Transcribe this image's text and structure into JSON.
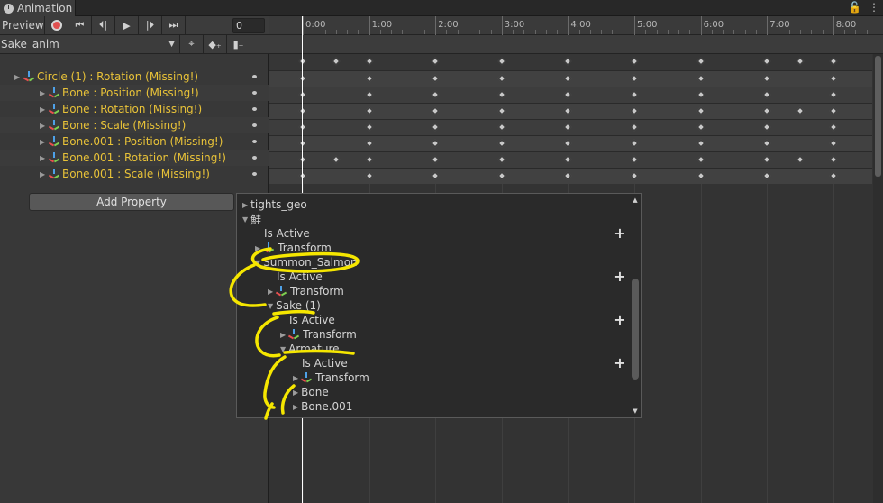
{
  "window": {
    "tab_title": "Animation",
    "icons": [
      "lock-icon",
      "menu-dots-icon"
    ]
  },
  "toolbar": {
    "preview_label": "Preview",
    "frame_value": "0",
    "buttons": [
      "record-icon",
      "first-key-icon",
      "prev-key-icon",
      "play-icon",
      "next-key-icon",
      "last-key-icon"
    ]
  },
  "clip": {
    "selected": "Sake_anim",
    "tools": [
      "filter-icon",
      "add-keyframe-icon",
      "add-event-icon"
    ]
  },
  "properties": [
    {
      "label": "Circle (1) : Rotation (Missing!)",
      "indent": 0
    },
    {
      "label": "Bone : Position (Missing!)",
      "indent": 1
    },
    {
      "label": "Bone : Rotation (Missing!)",
      "indent": 1
    },
    {
      "label": "Bone : Scale (Missing!)",
      "indent": 1
    },
    {
      "label": "Bone.001 : Position (Missing!)",
      "indent": 1
    },
    {
      "label": "Bone.001 : Rotation (Missing!)",
      "indent": 1
    },
    {
      "label": "Bone.001 : Scale (Missing!)",
      "indent": 1
    }
  ],
  "add_property_label": "Add Property",
  "ruler": {
    "labels": [
      "0:00",
      "1:00",
      "2:00",
      "3:00",
      "4:00",
      "5:00",
      "6:00",
      "7:00",
      "8:00"
    ]
  },
  "keyframes": {
    "summary": [
      0,
      0.5,
      1,
      2,
      3,
      4,
      5,
      6,
      7,
      7.5,
      8
    ],
    "rows": [
      [
        0,
        1,
        2,
        3,
        4,
        5,
        6,
        7,
        8
      ],
      [
        0,
        1,
        2,
        3,
        4,
        5,
        6,
        7,
        8
      ],
      [
        0,
        1,
        2,
        3,
        4,
        5,
        6,
        7,
        7.5,
        8
      ],
      [
        0,
        1,
        2,
        3,
        4,
        5,
        6,
        7,
        8
      ],
      [
        0,
        1,
        2,
        3,
        4,
        5,
        6,
        7,
        8
      ],
      [
        0,
        0.5,
        1,
        2,
        3,
        4,
        5,
        6,
        7,
        7.5,
        8
      ],
      [
        0,
        1,
        2,
        3,
        4,
        5,
        6,
        7,
        8
      ]
    ]
  },
  "popup": {
    "items": [
      {
        "label": "tights_geo",
        "indent": 0,
        "type": "collapsed"
      },
      {
        "label": "鮭",
        "indent": 0,
        "type": "expanded"
      },
      {
        "label": "Is Active",
        "indent": 1,
        "type": "leaf",
        "plus": true
      },
      {
        "label": "Transform",
        "indent": 1,
        "type": "transform"
      },
      {
        "label": "Summon_Salmon",
        "indent": 1,
        "type": "expanded"
      },
      {
        "label": "Is Active",
        "indent": 2,
        "type": "leaf",
        "plus": true
      },
      {
        "label": "Transform",
        "indent": 2,
        "type": "transform"
      },
      {
        "label": "Sake (1)",
        "indent": 2,
        "type": "expanded"
      },
      {
        "label": "Is Active",
        "indent": 3,
        "type": "leaf",
        "plus": true
      },
      {
        "label": "Transform",
        "indent": 3,
        "type": "transform"
      },
      {
        "label": "Armature",
        "indent": 3,
        "type": "expanded"
      },
      {
        "label": "Is Active",
        "indent": 4,
        "type": "leaf",
        "plus": true
      },
      {
        "label": "Transform",
        "indent": 4,
        "type": "transform"
      },
      {
        "label": "Bone",
        "indent": 4,
        "type": "collapsed"
      },
      {
        "label": "Bone.001",
        "indent": 4,
        "type": "collapsed"
      }
    ]
  },
  "colors": {
    "missing_text": "#e8c238",
    "annotation": "#f5e600",
    "record": "#e05050"
  }
}
